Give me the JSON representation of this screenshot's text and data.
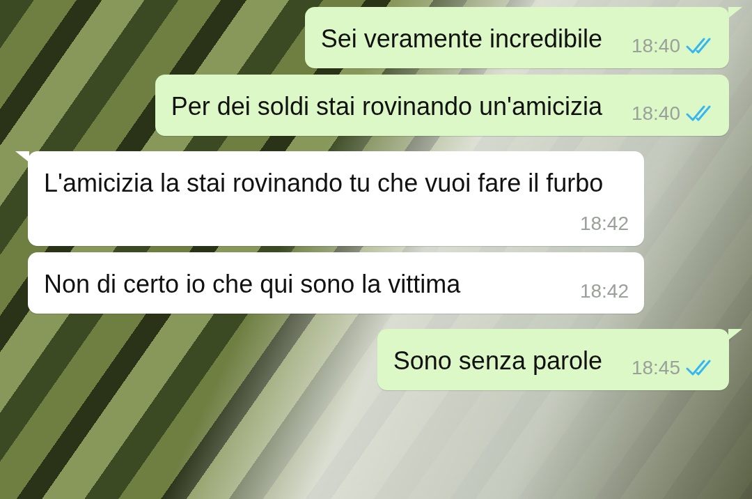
{
  "messages": [
    {
      "kind": "outgoing",
      "text": "Sei veramente incredibile",
      "time": "18:40",
      "read": true
    },
    {
      "kind": "outgoing",
      "text": "Per dei soldi stai rovinando un'amicizia",
      "time": "18:40",
      "read": true
    },
    {
      "kind": "incoming",
      "text": "L'amicizia la stai rovinando tu che vuoi fare il furbo",
      "time": "18:42"
    },
    {
      "kind": "incoming",
      "text": "Non di certo io che qui sono la vittima",
      "time": "18:42"
    },
    {
      "kind": "outgoing",
      "text": "Sono senza parole",
      "time": "18:45",
      "read": true
    }
  ]
}
